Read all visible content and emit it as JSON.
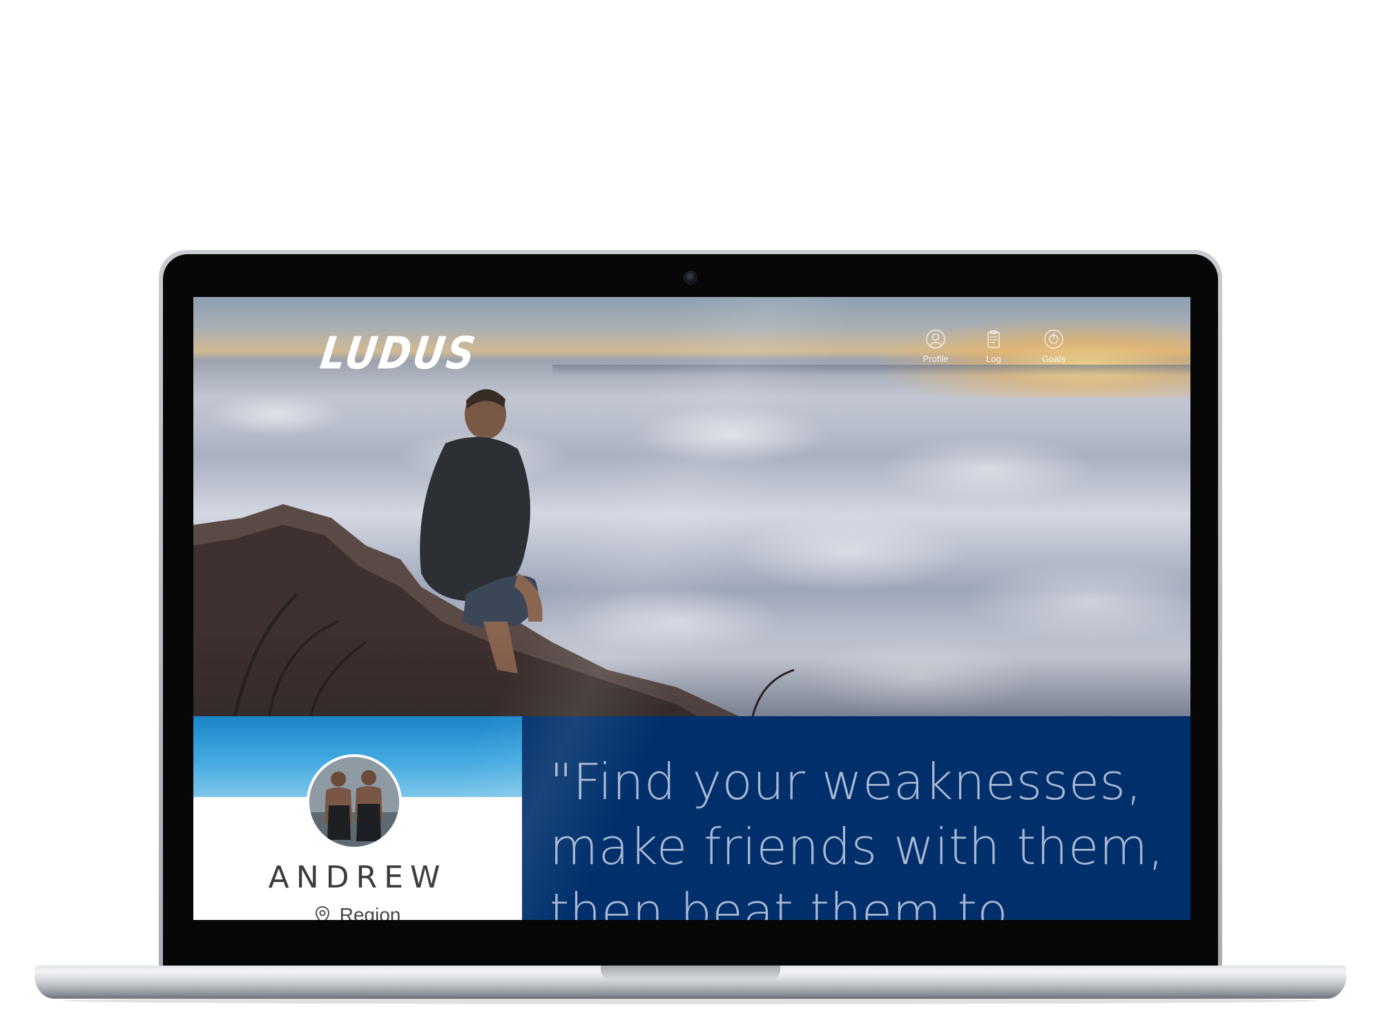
{
  "app": {
    "brand_name": "LUDUS"
  },
  "nav": {
    "items": [
      {
        "label": "Profile",
        "icon": "user-circle-icon"
      },
      {
        "label": "Log",
        "icon": "clipboard-icon"
      },
      {
        "label": "Goals",
        "icon": "target-icon"
      }
    ]
  },
  "profile": {
    "name": "ANDREW",
    "location": "Region",
    "location_icon": "map-pin-icon"
  },
  "quote": {
    "text": "\"Find your weaknesses, make friends with them, then beat them to"
  },
  "colors": {
    "quote_panel": "#002f6c",
    "profile_cover": "#2e9bd6",
    "profile_bg": "#ffffff",
    "quote_text": "#a9b7d2"
  }
}
